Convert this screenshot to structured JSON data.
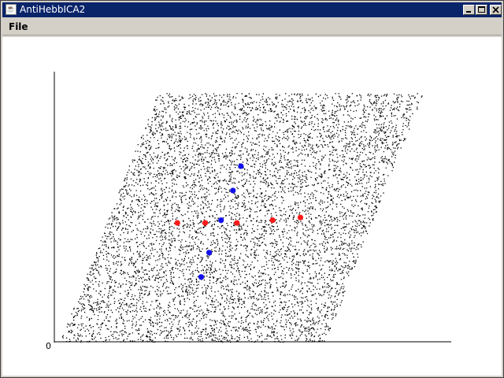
{
  "window": {
    "title": "AntiHebbICA2"
  },
  "menu": {
    "file_label": "File"
  },
  "plot": {
    "origin_label": "0",
    "point_color": "#000000",
    "red_color": "#ff1a1a",
    "blue_color": "#1010ee",
    "red_points": [
      [
        0.31,
        0.44
      ],
      [
        0.38,
        0.44
      ],
      [
        0.46,
        0.44
      ],
      [
        0.55,
        0.45
      ],
      [
        0.62,
        0.46
      ]
    ],
    "blue_points": [
      [
        0.47,
        0.65
      ],
      [
        0.45,
        0.56
      ],
      [
        0.42,
        0.45
      ],
      [
        0.39,
        0.33
      ],
      [
        0.37,
        0.24
      ]
    ]
  }
}
